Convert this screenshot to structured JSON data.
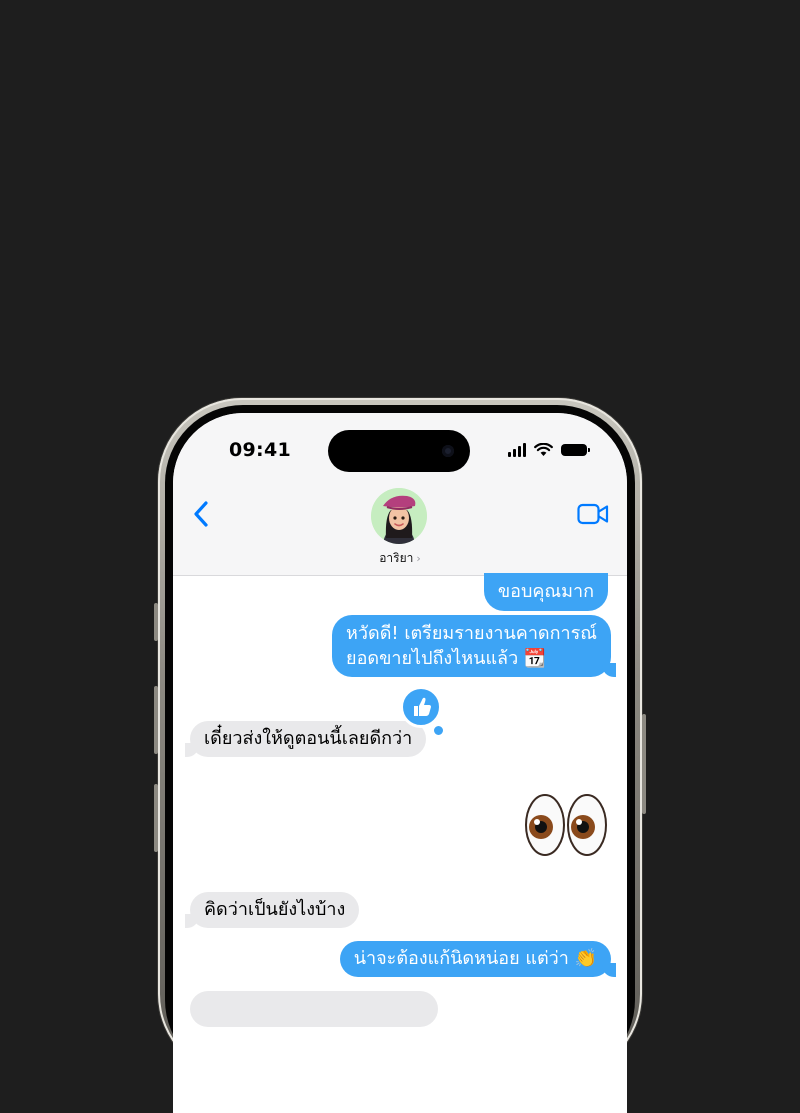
{
  "status_bar": {
    "time": "09:41"
  },
  "header": {
    "contact_name": "อาริยา",
    "back_icon": "chevron-left-icon",
    "video_icon": "video-camera-icon",
    "accent": "#007aff"
  },
  "messages": [
    {
      "direction": "sent",
      "text": "ขอบคุณมาก"
    },
    {
      "direction": "sent",
      "line1": "หวัดดี! เตรียมรายงานคาดการณ์",
      "line2": "ยอดขายไปถึงไหนแล้ว 📆"
    },
    {
      "direction": "received",
      "text": "เดี๋ยวส่งให้ดูตอนนี้เลยดีกว่า",
      "tapback": "thumbs-up-icon"
    },
    {
      "direction": "sent",
      "text": "👀"
    },
    {
      "direction": "received",
      "text": "คิดว่าเป็นยังไงบ้าง"
    },
    {
      "direction": "sent",
      "text": "น่าจะต้องแก้นิดหน่อย แต่ว่า 👏"
    }
  ],
  "colors": {
    "sent_bubble": "#3da4f5",
    "received_bubble": "#e9e9eb",
    "background": "#1e1e1e"
  }
}
